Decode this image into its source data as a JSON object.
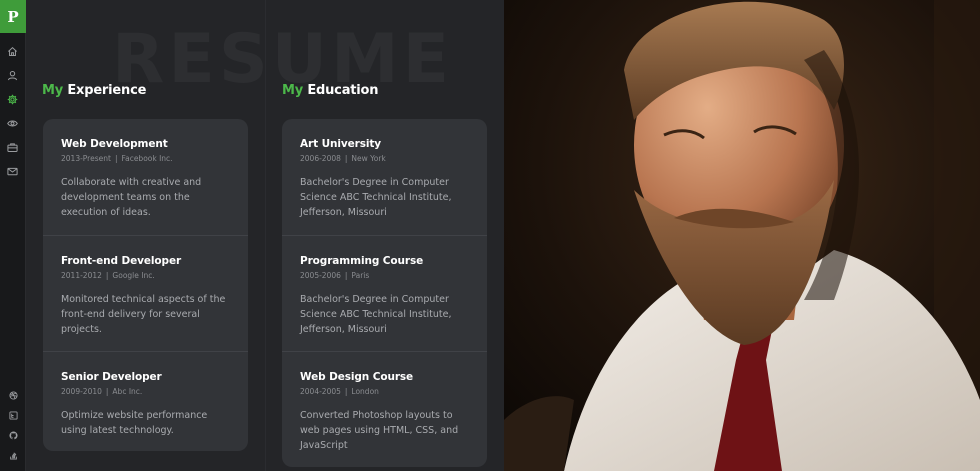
{
  "sidebar": {
    "logo_letter": "P",
    "nav": [
      {
        "icon": "home-icon"
      },
      {
        "icon": "user-icon"
      },
      {
        "icon": "gear-icon",
        "active": true
      },
      {
        "icon": "eye-icon"
      },
      {
        "icon": "briefcase-icon"
      },
      {
        "icon": "mail-icon"
      }
    ],
    "social": [
      {
        "icon": "dribbble-icon"
      },
      {
        "icon": "behance-icon"
      },
      {
        "icon": "github-icon"
      },
      {
        "icon": "stackoverflow-icon"
      }
    ]
  },
  "main": {
    "watermark": "RESUME",
    "experience": {
      "title_accent": "My",
      "title_rest": " Experience",
      "items": [
        {
          "title": "Web Development",
          "period": "2013-Present",
          "org": "Facebook Inc.",
          "desc": "Collaborate with creative and development teams on the execution of ideas."
        },
        {
          "title": "Front-end Developer",
          "period": "2011-2012",
          "org": "Google Inc.",
          "desc": "Monitored technical aspects of the front-end delivery for several projects."
        },
        {
          "title": "Senior Developer",
          "period": "2009-2010",
          "org": "Abc Inc.",
          "desc": "Optimize website performance using latest technology."
        }
      ]
    },
    "education": {
      "title_accent": "My",
      "title_rest": " Education",
      "items": [
        {
          "title": "Art University",
          "period": "2006-2008",
          "org": "New York",
          "desc": "Bachelor's Degree in Computer Science ABC Technical Institute, Jefferson, Missouri"
        },
        {
          "title": "Programming Course",
          "period": "2005-2006",
          "org": "Paris",
          "desc": "Bachelor's Degree in Computer Science ABC Technical Institute, Jefferson, Missouri"
        },
        {
          "title": "Web Design Course",
          "period": "2004-2005",
          "org": "London",
          "desc": "Converted Photoshop layouts to web pages using HTML, CSS, and JavaScript"
        }
      ]
    }
  },
  "colors": {
    "accent": "#4cb84a",
    "logo_bg": "#3f9c3a",
    "panel": "#242528",
    "card": "#323438"
  }
}
